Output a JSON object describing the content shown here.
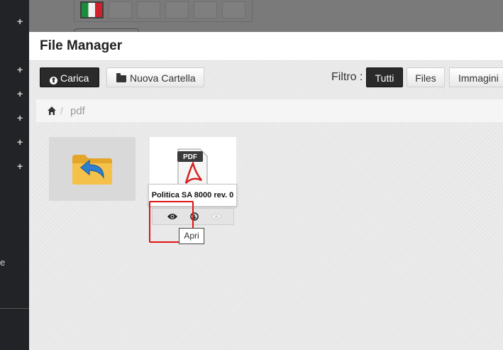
{
  "modal": {
    "title": "File Manager",
    "toolbar": {
      "upload_label": "Carica",
      "new_folder_label": "Nuova Cartella",
      "filter_label": "Filtro :",
      "filters": [
        "Tutti",
        "Files",
        "Immagini"
      ],
      "active_filter": "Tutti"
    },
    "breadcrumb": {
      "separator": "/",
      "current": "pdf"
    },
    "items": [
      {
        "type": "folder-up"
      },
      {
        "type": "pdf",
        "name": "Politica SA 8000 rev. 0"
      }
    ],
    "tooltip": "Apri",
    "colors": {
      "highlight": "#e01313",
      "primary_button": "#2a2a2a"
    }
  },
  "sidebar": {
    "plus_symbol": "+",
    "partial_text": "e"
  }
}
